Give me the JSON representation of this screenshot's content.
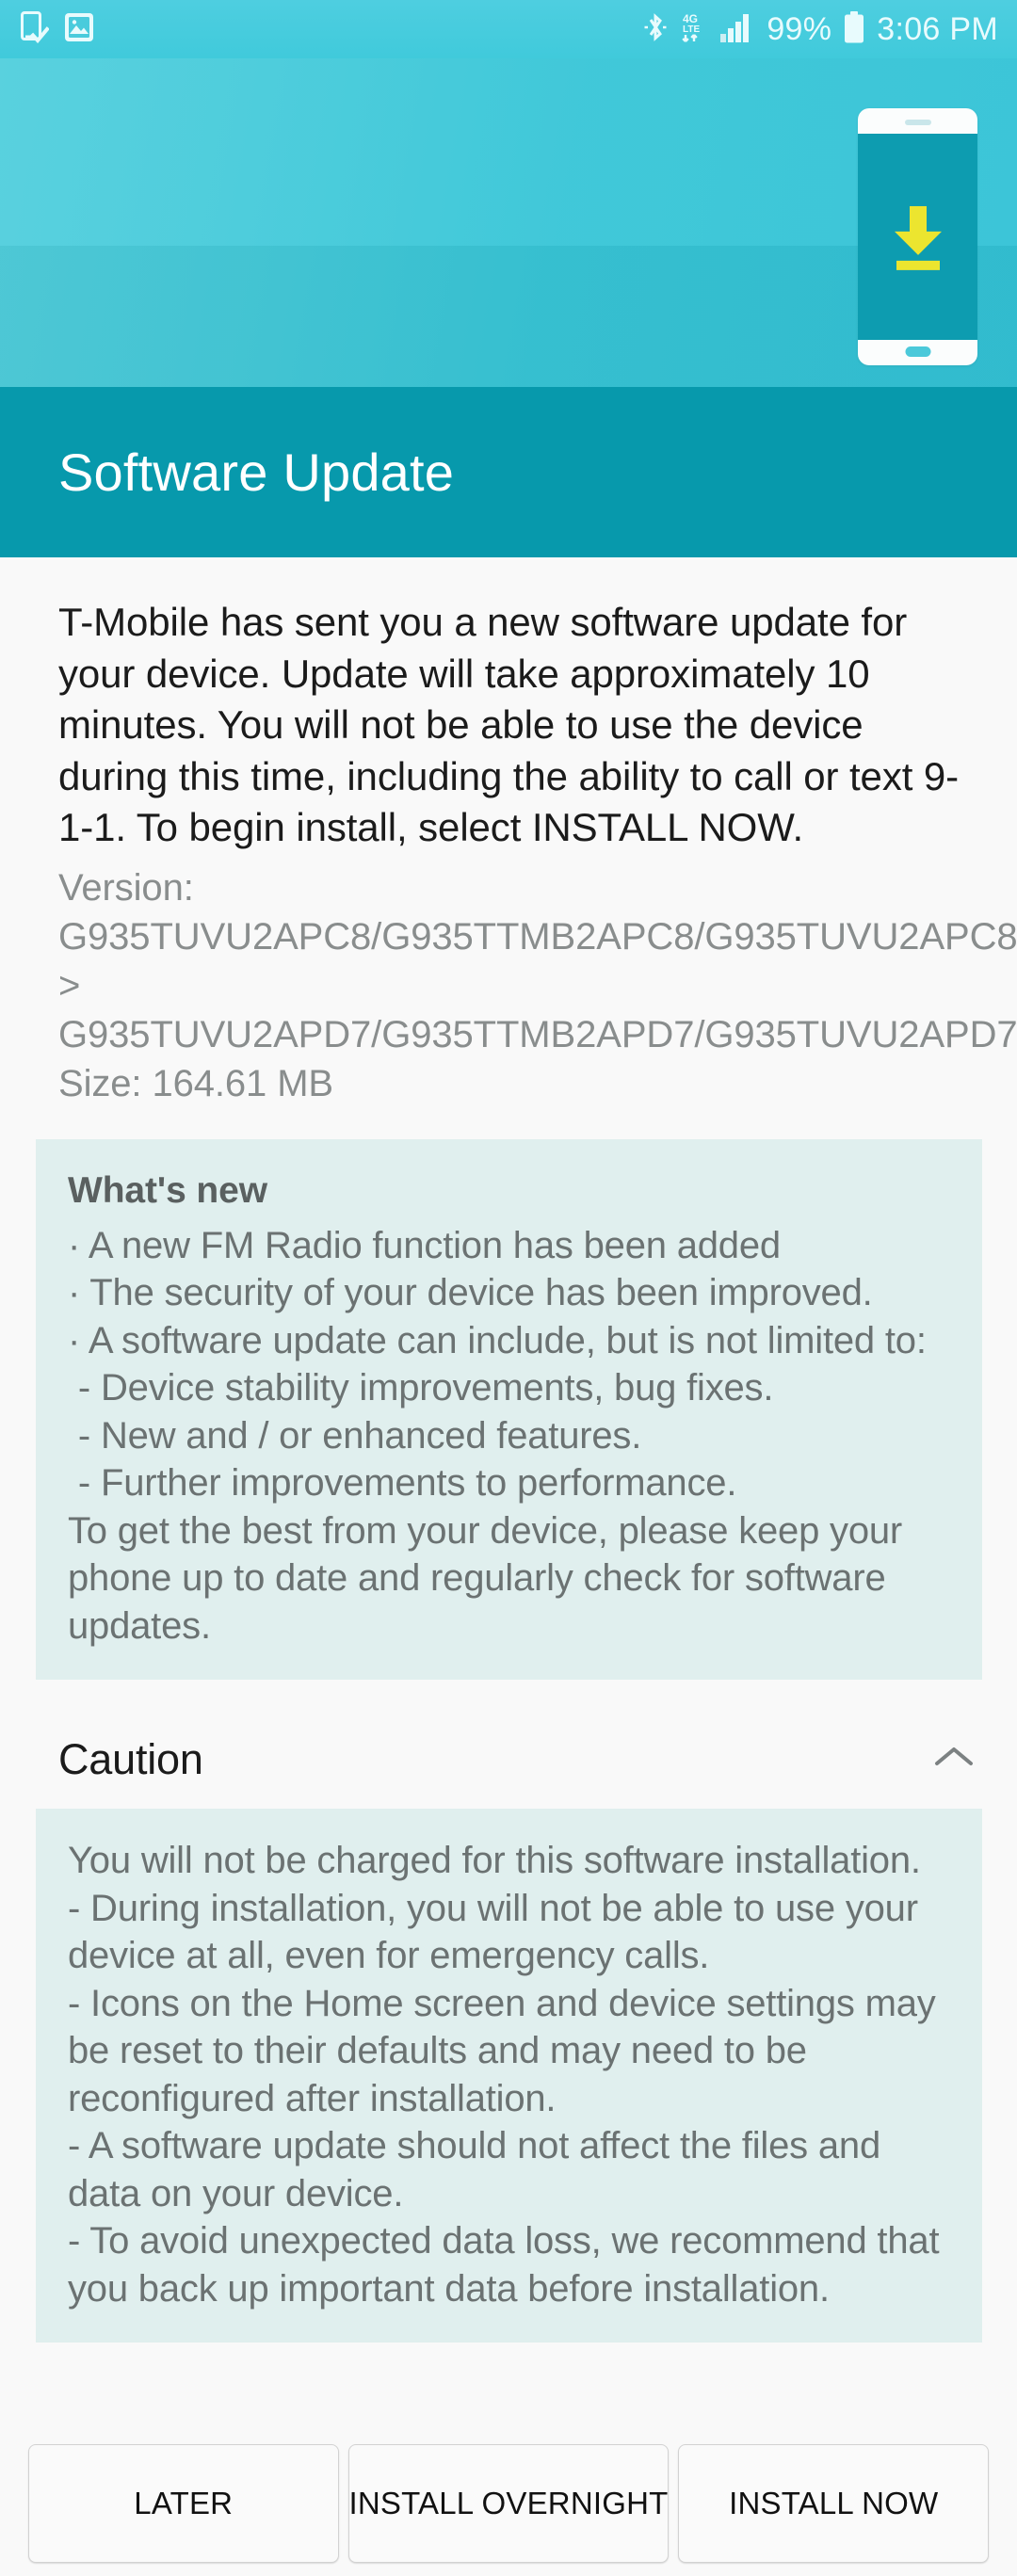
{
  "status_bar": {
    "left_icons": [
      "software-update-icon",
      "gallery-icon"
    ],
    "right_icons": [
      "bluetooth-icon",
      "4g-lte-icon",
      "signal-bars-icon",
      "battery-icon"
    ],
    "network_label": "4G LTE",
    "battery_percent": "99%",
    "time": "3:06 PM"
  },
  "hero": {
    "illustration": "phone-download-icon",
    "background_color": "#38c6d7",
    "screen_color": "#0d9cb0",
    "arrow_color": "#ece52f"
  },
  "header": {
    "title": "Software Update",
    "background_color": "#0799ac",
    "text_color": "#ffffff"
  },
  "body": {
    "intro": "T-Mobile has sent you a new software update for your device. Update will take approximately 10 minutes. You will not be able to use the device during this time, including the ability to call or text 9-1-1. To begin install, select INSTALL NOW.",
    "version_label": "Version: G935TUVU2APC8/G935TTMB2APC8/G935TUVU2APC8 > G935TUVU2APD7/G935TTMB2APD7/G935TUVU2APD7",
    "size_label": "Size: 164.61 MB"
  },
  "whats_new": {
    "heading": "What's new",
    "body": "· A new FM Radio function has been added\n· The security of your device has been improved.\n· A software update can include, but is not limited to:\n - Device stability improvements, bug fixes.\n - New and / or enhanced features.\n - Further improvements to performance.\nTo get the best from your device, please keep your phone up to date and regularly check for software updates.",
    "background_color": "#e0efee"
  },
  "caution": {
    "heading": "Caution",
    "expanded": true,
    "toggle_icon": "chevron-up-icon",
    "body": "You will not be charged for this software installation.\n- During installation, you will not be able to use your device at all, even for emergency calls.\n- Icons on the Home screen and device settings may be reset to their defaults and may need to be reconfigured after installation.\n- A software update should not affect the files and data on your device.\n- To avoid unexpected data loss, we recommend that you back up important data before installation.",
    "background_color": "#e0efee"
  },
  "buttons": {
    "later": "LATER",
    "install_overnight": "INSTALL OVERNIGHT",
    "install_now": "INSTALL NOW"
  }
}
